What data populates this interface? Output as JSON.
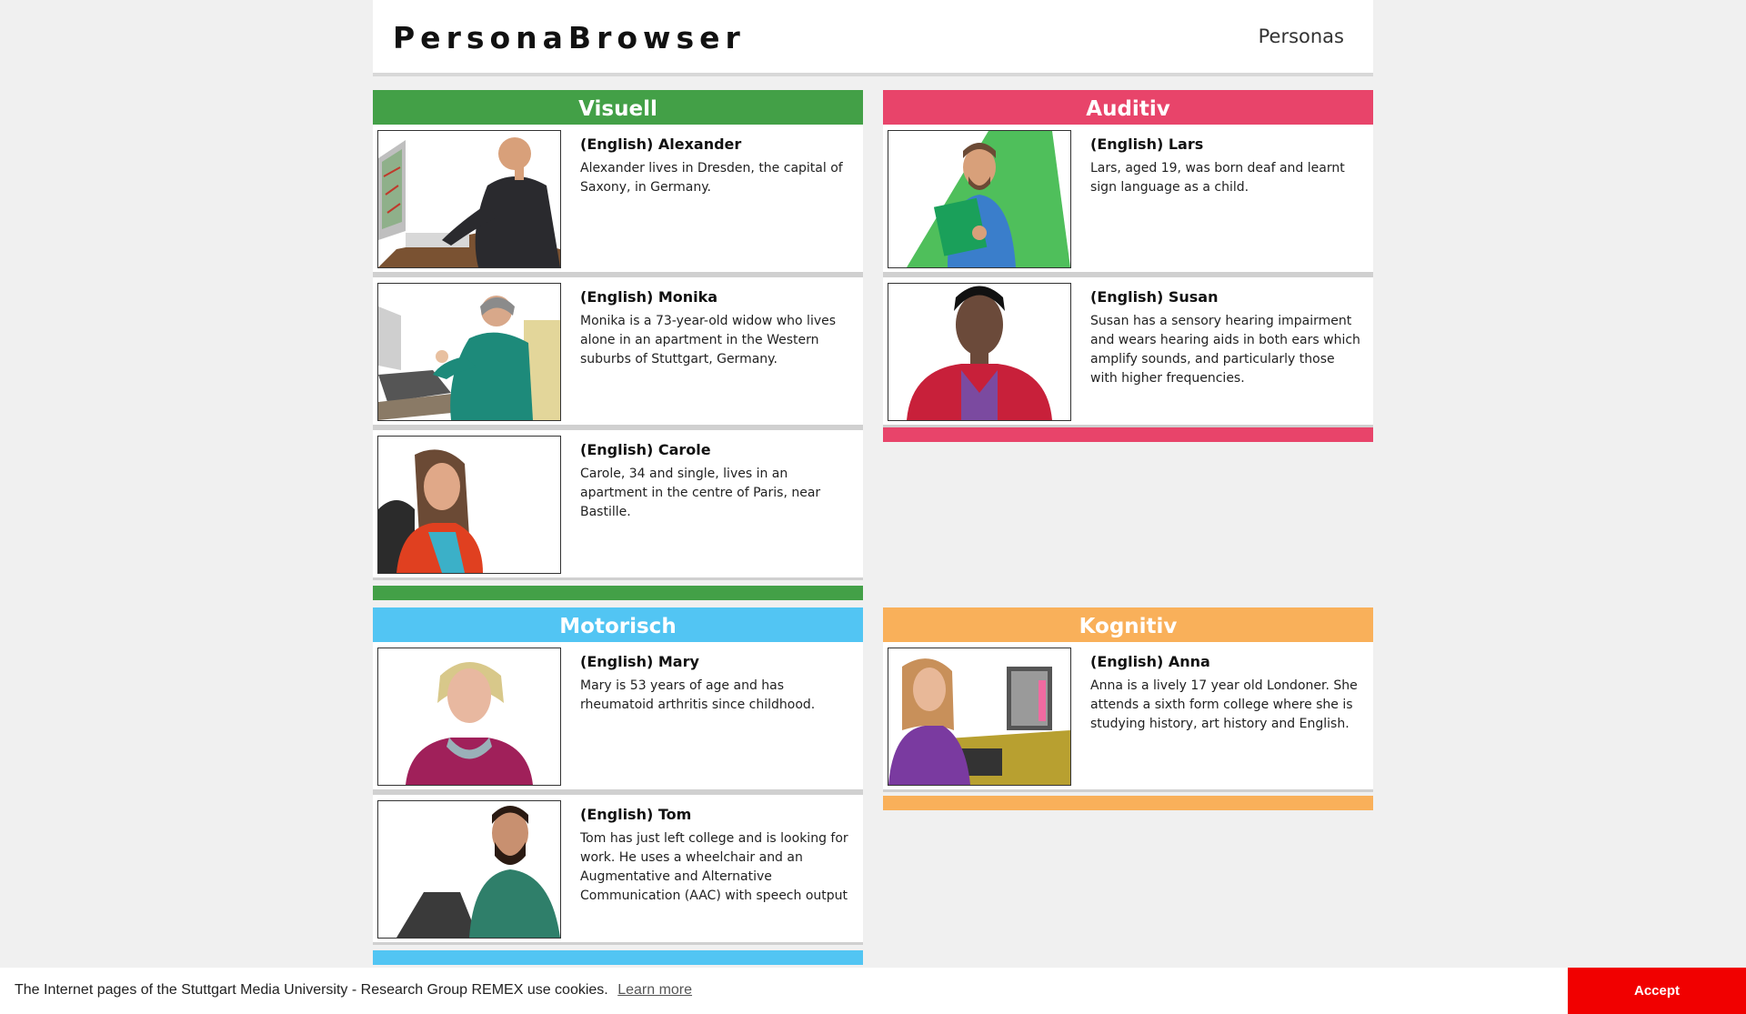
{
  "header": {
    "brand": "PersonaBrowser",
    "nav_link": "Personas"
  },
  "categories": [
    {
      "name": "Visuell",
      "color": "#43a047",
      "personas": [
        {
          "name": "(English) Alexander",
          "desc": "Alexander lives in Dresden, the capital of Saxony, in Germany."
        },
        {
          "name": "(English) Monika",
          "desc": "Monika is a 73-year-old widow who lives alone in an apartment in the Western suburbs of Stuttgart, Germany."
        },
        {
          "name": "(English) Carole",
          "desc": "Carole, 34 and single, lives in an apartment in the centre of Paris, near Bastille."
        }
      ]
    },
    {
      "name": "Auditiv",
      "color": "#e8446a",
      "personas": [
        {
          "name": "(English) Lars",
          "desc": "Lars, aged 19, was born deaf and learnt sign language as a child."
        },
        {
          "name": "(English) Susan",
          "desc": "Susan has a sensory hearing impairment and wears hearing aids in both ears which amplify sounds, and particularly those with higher frequencies."
        }
      ]
    },
    {
      "name": "Motorisch",
      "color": "#52c5f3",
      "personas": [
        {
          "name": "(English) Mary",
          "desc": "Mary is 53 years of age and has rheumatoid arthritis since childhood."
        },
        {
          "name": "(English) Tom",
          "desc": "Tom has just left college and is looking for work. He uses a wheelchair and an Augmentative and Alternative Communication (AAC) with speech output"
        }
      ]
    },
    {
      "name": "Kognitiv",
      "color": "#f9b05a",
      "personas": [
        {
          "name": "(English) Anna",
          "desc": "Anna is a lively 17 year old Londoner. She attends a sixth form college where she is studying history, art history and English."
        }
      ]
    }
  ],
  "cookie": {
    "message": "The Internet pages of the Stuttgart Media University - Research Group REMEX use cookies.",
    "learn_more": "Learn more",
    "accept": "Accept"
  }
}
